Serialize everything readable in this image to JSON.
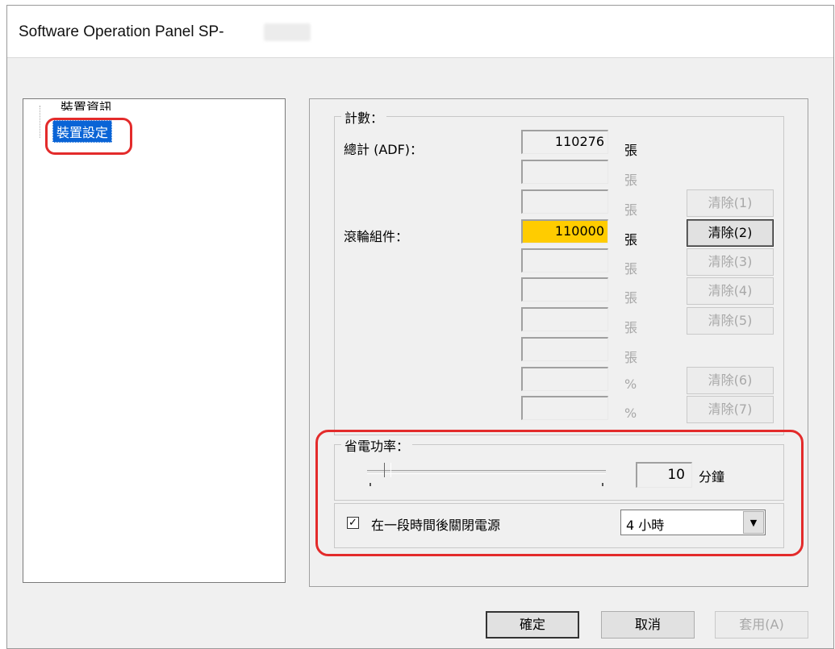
{
  "window": {
    "title": "Software Operation Panel SP-"
  },
  "tree": {
    "items": [
      {
        "label": "裝置資訊"
      },
      {
        "label": "裝置設定",
        "selected": true
      }
    ]
  },
  "counters": {
    "legend": "計數：",
    "total_label": "總計 (ADF)：",
    "roller_label": "滾輪組件：",
    "rows": [
      {
        "value": "110276",
        "unit": "張",
        "enabled": true,
        "highlight": false,
        "button": null
      },
      {
        "value": "",
        "unit": "張",
        "enabled": false,
        "highlight": false,
        "button": null
      },
      {
        "value": "",
        "unit": "張",
        "enabled": false,
        "highlight": false,
        "button": "清除(1)"
      },
      {
        "value": "110000",
        "unit": "張",
        "enabled": true,
        "highlight": true,
        "button": "清除(2)"
      },
      {
        "value": "",
        "unit": "張",
        "enabled": false,
        "highlight": false,
        "button": "清除(3)"
      },
      {
        "value": "",
        "unit": "張",
        "enabled": false,
        "highlight": false,
        "button": "清除(4)"
      },
      {
        "value": "",
        "unit": "張",
        "enabled": false,
        "highlight": false,
        "button": "清除(5)"
      },
      {
        "value": "",
        "unit": "張",
        "enabled": false,
        "highlight": false,
        "button": null
      },
      {
        "value": "",
        "unit": "%",
        "enabled": false,
        "highlight": false,
        "button": "清除(6)"
      },
      {
        "value": "",
        "unit": "%",
        "enabled": false,
        "highlight": false,
        "button": "清除(7)"
      }
    ]
  },
  "power_saving": {
    "legend": "省電功率：",
    "minutes_value": "10",
    "minutes_unit": "分鐘"
  },
  "auto_power_off": {
    "checked": true,
    "check_mark": "✓",
    "label": "在一段時間後關閉電源",
    "selected_option": "4 小時",
    "arrow": "▼"
  },
  "buttons": {
    "ok": "確定",
    "cancel": "取消",
    "apply": "套用(A)"
  },
  "colors": {
    "highlight_counter": "#ffcc00",
    "selection": "#0a64d6",
    "annotation": "#e32b2b"
  }
}
